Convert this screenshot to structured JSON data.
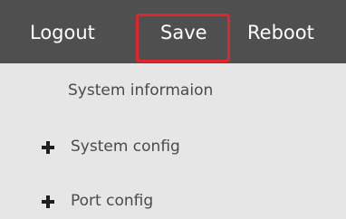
{
  "topbar": {
    "buttons": [
      {
        "label": "Logout"
      },
      {
        "label": "Save"
      },
      {
        "label": "Reboot"
      }
    ],
    "highlight_color": "#e0262a"
  },
  "menu": {
    "items": [
      {
        "label": "System informaion",
        "expandable": false
      },
      {
        "label": "System config",
        "expandable": true,
        "icon": "plus-icon"
      },
      {
        "label": "Port config",
        "expandable": true,
        "icon": "plus-icon"
      }
    ]
  },
  "colors": {
    "topbar_bg": "#4f4f4f",
    "menu_bg": "#e6e6e6",
    "menu_text": "#4a4a4a"
  }
}
